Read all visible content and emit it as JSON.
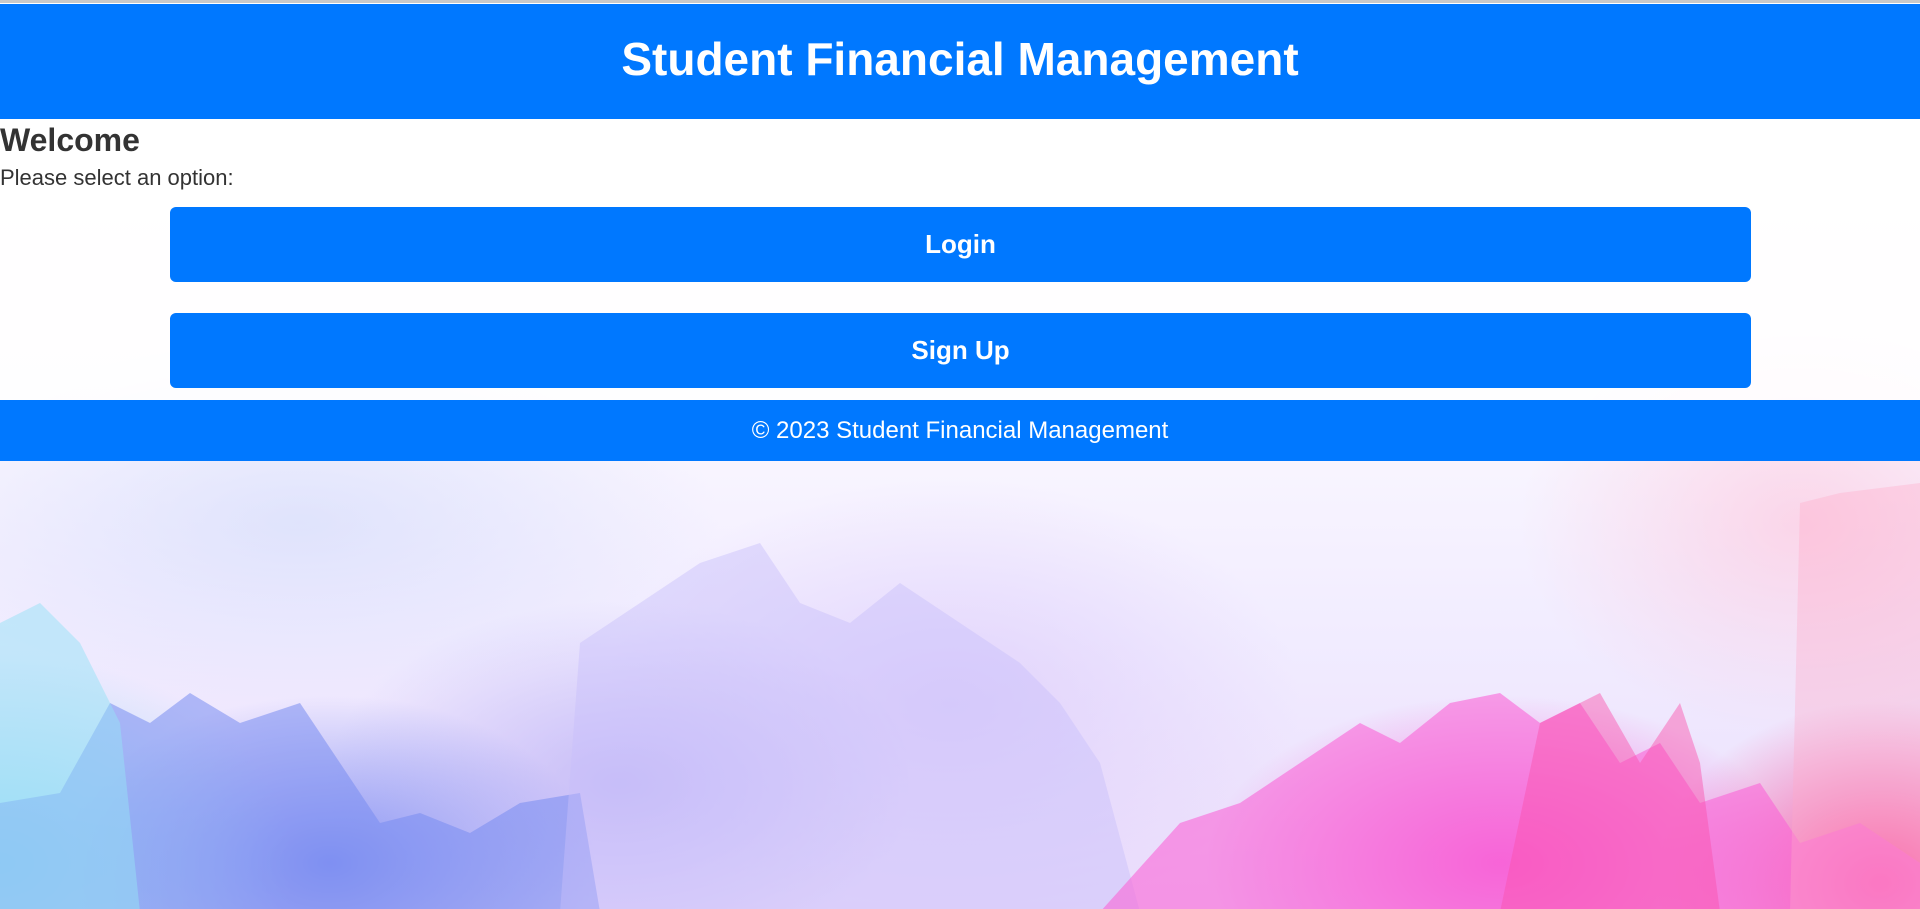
{
  "header": {
    "title": "Student Financial Management"
  },
  "main": {
    "heading": "Welcome",
    "prompt": "Please select an option:",
    "login_label": "Login",
    "signup_label": "Sign Up"
  },
  "footer": {
    "copyright": "© 2023 Student Financial Management"
  },
  "colors": {
    "primary": "#0078ff",
    "text": "#333333",
    "button_text": "#ffffff"
  }
}
